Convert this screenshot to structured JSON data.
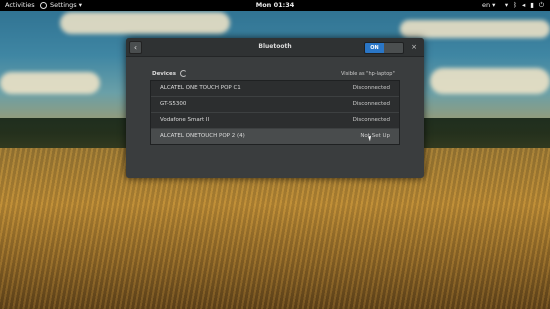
{
  "topbar": {
    "activities": "Activities",
    "app_menu": "Settings ▾",
    "clock": "Mon 01:34",
    "input_lang": "en ▾",
    "status_icons": [
      "wifi-icon",
      "bluetooth-icon",
      "volume-icon",
      "battery-icon",
      "power-icon"
    ]
  },
  "dialog": {
    "title": "Bluetooth",
    "switch_label": "ON",
    "back_glyph": "‹",
    "close_glyph": "×"
  },
  "devices": {
    "header": "Devices",
    "visible_as": "Visible as \"hp-laptop\"",
    "items": [
      {
        "name": "ALCATEL ONE TOUCH POP C1",
        "state": "Disconnected"
      },
      {
        "name": "GT-S5300",
        "state": "Disconnected"
      },
      {
        "name": "Vodafone Smart II",
        "state": "Disconnected"
      },
      {
        "name": "ALCATEL ONETOUCH POP 2 (4)",
        "state": "Not Set Up"
      }
    ]
  },
  "colors": {
    "switch_on": "#2a76c6",
    "dialog_bg": "#3a3d3e",
    "topbar_bg": "#000000"
  }
}
